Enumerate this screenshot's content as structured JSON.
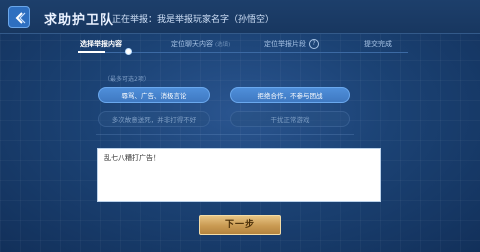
{
  "header": {
    "title": "求助护卫队",
    "subtitle": "正在举报：我是举报玩家名字（孙悟空）"
  },
  "steps": [
    {
      "label": "选择举报内容",
      "note": ""
    },
    {
      "label": "定位聊天内容",
      "note": "(选填)"
    },
    {
      "label": "定位举报片段",
      "note": ""
    },
    {
      "label": "提交完成",
      "note": ""
    }
  ],
  "step_help_icon_text": "?",
  "progress": {
    "current_step": 1,
    "total_steps": 4
  },
  "hint": "（最多可选2项）",
  "options": [
    {
      "label": "辱骂、广告、消极言论",
      "selected": true
    },
    {
      "label": "拒绝合作，不参与团战",
      "selected": true
    },
    {
      "label": "多次故意送死，并非打得不好",
      "selected": false
    },
    {
      "label": "干扰正常游戏",
      "selected": false
    }
  ],
  "textarea": {
    "value": "乱七八糟打广告！"
  },
  "next_button": {
    "label": "下一步"
  },
  "colors": {
    "accent": "#4f8fda",
    "next_button": "#c99a52",
    "background": "#1b4274"
  },
  "icons": {
    "back": "back-arrow-icon",
    "help": "help-icon"
  }
}
